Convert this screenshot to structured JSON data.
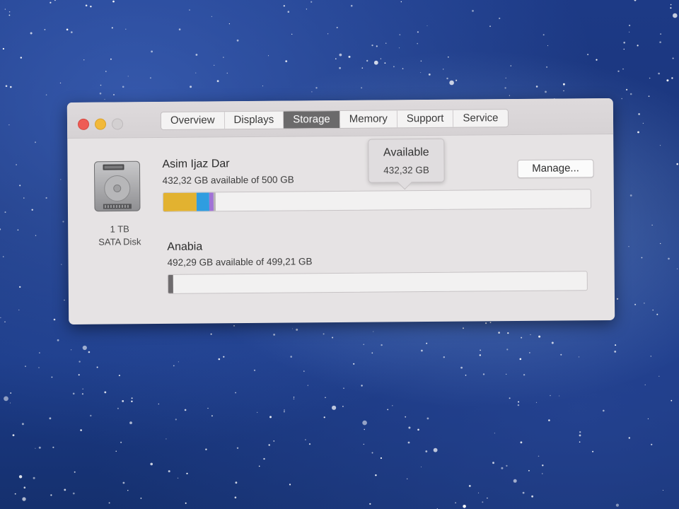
{
  "window": {
    "title_controls": [
      "close",
      "minimize",
      "zoom"
    ],
    "tabs": [
      {
        "label": "Overview",
        "active": false
      },
      {
        "label": "Displays",
        "active": false
      },
      {
        "label": "Storage",
        "active": true
      },
      {
        "label": "Memory",
        "active": false
      },
      {
        "label": "Support",
        "active": false
      },
      {
        "label": "Service",
        "active": false
      }
    ]
  },
  "disk": {
    "icon": "hard-disk-icon",
    "size_label": "1 TB",
    "type_label": "SATA Disk"
  },
  "volumes": [
    {
      "name": "Asim Ijaz Dar",
      "info": "432,32 GB available of 500 GB",
      "segments": [
        {
          "color": "#e2b230",
          "fraction": 0.077
        },
        {
          "color": "#2f9de0",
          "fraction": 0.03
        },
        {
          "color": "#a072d6",
          "fraction": 0.01
        },
        {
          "color": "#b8b4b6",
          "fraction": 0.005
        }
      ]
    },
    {
      "name": "Anabia",
      "info": "492,29 GB available of 499,21 GB",
      "segments": [
        {
          "color": "#6f6c6e",
          "fraction": 0.012
        }
      ]
    }
  ],
  "manage_button": {
    "label": "Manage..."
  },
  "tooltip": {
    "title": "Available",
    "value": "432,32 GB"
  }
}
